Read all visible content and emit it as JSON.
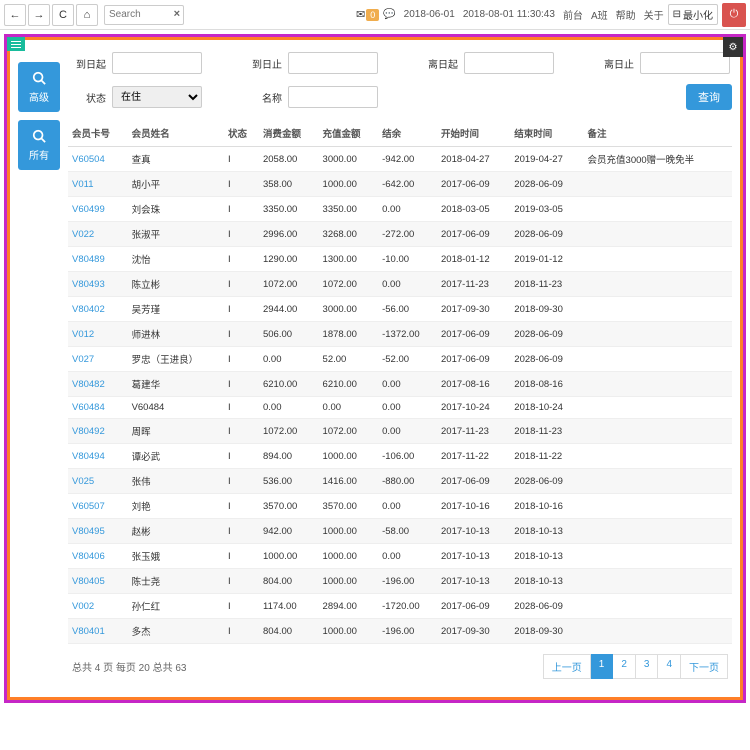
{
  "topbar": {
    "search_placeholder": "Search",
    "mail_badge": "0",
    "date_from": "2018-06-01",
    "date_to": "2018-08-01 11:30:43",
    "links": {
      "front": "前台",
      "shift": "A班",
      "help": "帮助",
      "about": "关于"
    },
    "minimize": "最小化"
  },
  "side": {
    "advanced": "高级",
    "all": "所有"
  },
  "filters": {
    "arrive_from": "到日起",
    "arrive_to": "到日止",
    "leave_from": "离日起",
    "leave_to": "离日止",
    "status_label": "状态",
    "status_value": "在住",
    "name_label": "名称",
    "query": "查询"
  },
  "columns": [
    "会员卡号",
    "会员姓名",
    "状态",
    "消费金额",
    "充值金额",
    "结余",
    "开始时间",
    "结束时间",
    "备注"
  ],
  "rows": [
    {
      "c": "V60504",
      "n": "查真",
      "s": "I",
      "a": "2058.00",
      "b": "3000.00",
      "d": "-942.00",
      "f": "2018-04-27",
      "t": "2019-04-27",
      "r": "会员充值3000赠一晚免半"
    },
    {
      "c": "V011",
      "n": "胡小平",
      "s": "I",
      "a": "358.00",
      "b": "1000.00",
      "d": "-642.00",
      "f": "2017-06-09",
      "t": "2028-06-09",
      "r": ""
    },
    {
      "c": "V60499",
      "n": "刘会珠",
      "s": "I",
      "a": "3350.00",
      "b": "3350.00",
      "d": "0.00",
      "f": "2018-03-05",
      "t": "2019-03-05",
      "r": ""
    },
    {
      "c": "V022",
      "n": "张淑平",
      "s": "I",
      "a": "2996.00",
      "b": "3268.00",
      "d": "-272.00",
      "f": "2017-06-09",
      "t": "2028-06-09",
      "r": ""
    },
    {
      "c": "V80489",
      "n": "沈怡",
      "s": "I",
      "a": "1290.00",
      "b": "1300.00",
      "d": "-10.00",
      "f": "2018-01-12",
      "t": "2019-01-12",
      "r": ""
    },
    {
      "c": "V80493",
      "n": "陈立彬",
      "s": "I",
      "a": "1072.00",
      "b": "1072.00",
      "d": "0.00",
      "f": "2017-11-23",
      "t": "2018-11-23",
      "r": ""
    },
    {
      "c": "V80402",
      "n": "吴芳瑾",
      "s": "I",
      "a": "2944.00",
      "b": "3000.00",
      "d": "-56.00",
      "f": "2017-09-30",
      "t": "2018-09-30",
      "r": ""
    },
    {
      "c": "V012",
      "n": "师进林",
      "s": "I",
      "a": "506.00",
      "b": "1878.00",
      "d": "-1372.00",
      "f": "2017-06-09",
      "t": "2028-06-09",
      "r": ""
    },
    {
      "c": "V027",
      "n": "罗忠（王进良）",
      "s": "I",
      "a": "0.00",
      "b": "52.00",
      "d": "-52.00",
      "f": "2017-06-09",
      "t": "2028-06-09",
      "r": ""
    },
    {
      "c": "V80482",
      "n": "葛建华",
      "s": "I",
      "a": "6210.00",
      "b": "6210.00",
      "d": "0.00",
      "f": "2017-08-16",
      "t": "2018-08-16",
      "r": ""
    },
    {
      "c": "V60484",
      "n": "V60484",
      "s": "I",
      "a": "0.00",
      "b": "0.00",
      "d": "0.00",
      "f": "2017-10-24",
      "t": "2018-10-24",
      "r": ""
    },
    {
      "c": "V80492",
      "n": "周晖",
      "s": "I",
      "a": "1072.00",
      "b": "1072.00",
      "d": "0.00",
      "f": "2017-11-23",
      "t": "2018-11-23",
      "r": ""
    },
    {
      "c": "V80494",
      "n": "谭必武",
      "s": "I",
      "a": "894.00",
      "b": "1000.00",
      "d": "-106.00",
      "f": "2017-11-22",
      "t": "2018-11-22",
      "r": ""
    },
    {
      "c": "V025",
      "n": "张伟",
      "s": "I",
      "a": "536.00",
      "b": "1416.00",
      "d": "-880.00",
      "f": "2017-06-09",
      "t": "2028-06-09",
      "r": ""
    },
    {
      "c": "V60507",
      "n": "刘艳",
      "s": "I",
      "a": "3570.00",
      "b": "3570.00",
      "d": "0.00",
      "f": "2017-10-16",
      "t": "2018-10-16",
      "r": ""
    },
    {
      "c": "V80495",
      "n": "赵彬",
      "s": "I",
      "a": "942.00",
      "b": "1000.00",
      "d": "-58.00",
      "f": "2017-10-13",
      "t": "2018-10-13",
      "r": ""
    },
    {
      "c": "V80406",
      "n": "张玉娥",
      "s": "I",
      "a": "1000.00",
      "b": "1000.00",
      "d": "0.00",
      "f": "2017-10-13",
      "t": "2018-10-13",
      "r": ""
    },
    {
      "c": "V80405",
      "n": "陈士尧",
      "s": "I",
      "a": "804.00",
      "b": "1000.00",
      "d": "-196.00",
      "f": "2017-10-13",
      "t": "2018-10-13",
      "r": ""
    },
    {
      "c": "V002",
      "n": "孙仁红",
      "s": "I",
      "a": "1174.00",
      "b": "2894.00",
      "d": "-1720.00",
      "f": "2017-06-09",
      "t": "2028-06-09",
      "r": ""
    },
    {
      "c": "V80401",
      "n": "多杰",
      "s": "I",
      "a": "804.00",
      "b": "1000.00",
      "d": "-196.00",
      "f": "2017-09-30",
      "t": "2018-09-30",
      "r": ""
    }
  ],
  "footer": {
    "info": "总共 4 页 每页 20 总共 63"
  },
  "pager": {
    "prev": "上一页",
    "next": "下一页",
    "pages": [
      "1",
      "2",
      "3",
      "4"
    ],
    "active": 0
  }
}
